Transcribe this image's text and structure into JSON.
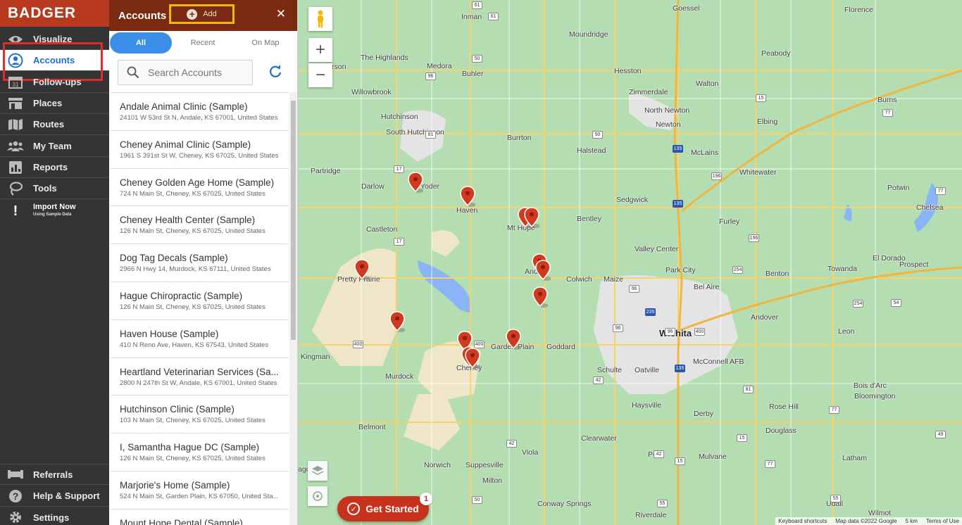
{
  "app": {
    "logo": "BADGER"
  },
  "nav": {
    "items": [
      {
        "label": "Visualize",
        "icon": "eye-icon"
      },
      {
        "label": "Accounts",
        "icon": "user-circle-icon"
      },
      {
        "label": "Follow-ups",
        "icon": "calendar-icon",
        "icon_text": "31"
      },
      {
        "label": "Places",
        "icon": "store-icon"
      },
      {
        "label": "Routes",
        "icon": "map-icon"
      },
      {
        "label": "My Team",
        "icon": "team-icon"
      },
      {
        "label": "Reports",
        "icon": "chart-icon"
      },
      {
        "label": "Tools",
        "icon": "lasso-icon"
      }
    ],
    "import": {
      "title": "Import Now",
      "subtitle": "Using Sample Data"
    },
    "bottom": [
      {
        "label": "Referrals",
        "icon": "referral-icon"
      },
      {
        "label": "Help & Support",
        "icon": "help-icon"
      },
      {
        "label": "Settings",
        "icon": "gear-icon"
      }
    ]
  },
  "panel": {
    "title": "Accounts",
    "add_label": "Add",
    "close_label": "✕",
    "tabs": [
      "All",
      "Recent",
      "On Map"
    ],
    "search_placeholder": "Search Accounts",
    "accounts": [
      {
        "name": "Andale Animal Clinic (Sample)",
        "address": "24101 W 53rd St N, Andale, KS 67001, United States"
      },
      {
        "name": "Cheney Animal Clinic (Sample)",
        "address": "1961 S 391st St W, Cheney, KS 67025, United States"
      },
      {
        "name": "Cheney Golden Age Home (Sample)",
        "address": "724 N Main St, Cheney, KS 67025, United States"
      },
      {
        "name": "Cheney Health Center (Sample)",
        "address": "126 N Main St, Cheney, KS 67025, United States"
      },
      {
        "name": "Dog Tag Decals (Sample)",
        "address": "2966 N Hwy 14, Murdock, KS 67111, United States"
      },
      {
        "name": "Hague Chiropractic (Sample)",
        "address": "126 N Main St, Cheney, KS 67025, United States"
      },
      {
        "name": "Haven House (Sample)",
        "address": "410 N Reno Ave, Haven, KS 67543, United States"
      },
      {
        "name": "Heartland Veterinarian Services (Sa...",
        "address": "2800 N 247th St W, Andale, KS 67001, United States"
      },
      {
        "name": "Hutchinson Clinic (Sample)",
        "address": "103 N Main St, Cheney, KS 67025, United States"
      },
      {
        "name": "I, Samantha Hague DC (Sample)",
        "address": "126 N Main St, Cheney, KS 67025, United States"
      },
      {
        "name": "Marjorie's Home (Sample)",
        "address": "524 N Main St, Garden Plain, KS 67050, United Sta..."
      },
      {
        "name": "Mount Hope Dental (Sample)",
        "address": ""
      }
    ]
  },
  "map": {
    "towns": [
      {
        "name": "Goessel"
      },
      {
        "name": "Florence"
      },
      {
        "name": "Inman"
      },
      {
        "name": "Moundridge"
      },
      {
        "name": "Peabody"
      },
      {
        "name": "The Highlands"
      },
      {
        "name": "Medora"
      },
      {
        "name": "Buhler"
      },
      {
        "name": "Hesston"
      },
      {
        "name": "rson"
      },
      {
        "name": "Willowbrook"
      },
      {
        "name": "Zimmerdale"
      },
      {
        "name": "Walton"
      },
      {
        "name": "Hutchinson"
      },
      {
        "name": "North Newton"
      },
      {
        "name": "Newton"
      },
      {
        "name": "Burns"
      },
      {
        "name": "South Hutchinson"
      },
      {
        "name": "Burrton"
      },
      {
        "name": "Elbing"
      },
      {
        "name": "Halstead"
      },
      {
        "name": "McLains"
      },
      {
        "name": "Partridge"
      },
      {
        "name": "Whitewater"
      },
      {
        "name": "Darlow"
      },
      {
        "name": "Yoder"
      },
      {
        "name": "Potwin"
      },
      {
        "name": "Haven"
      },
      {
        "name": "Sedgwick"
      },
      {
        "name": "Chelsea"
      },
      {
        "name": "Mt Hope"
      },
      {
        "name": "Bentley"
      },
      {
        "name": "Furley"
      },
      {
        "name": "Castleton"
      },
      {
        "name": "Valley Center"
      },
      {
        "name": "Andale"
      },
      {
        "name": "Park City"
      },
      {
        "name": "El Dorado"
      },
      {
        "name": "Prospect"
      },
      {
        "name": "Benton"
      },
      {
        "name": "Towanda"
      },
      {
        "name": "Pretty Prairie"
      },
      {
        "name": "Colwich"
      },
      {
        "name": "Maize"
      },
      {
        "name": "Bel Aire"
      },
      {
        "name": "Andover"
      },
      {
        "name": "Wichita"
      },
      {
        "name": "Garden Plain"
      },
      {
        "name": "Goddard"
      },
      {
        "name": "Leon"
      },
      {
        "name": "Kingman"
      },
      {
        "name": "Cheney"
      },
      {
        "name": "McConnell AFB"
      },
      {
        "name": "Murdock"
      },
      {
        "name": "Schulte"
      },
      {
        "name": "Oatville"
      },
      {
        "name": "Bois d'Arc"
      },
      {
        "name": "Bloomington"
      },
      {
        "name": "Haysville"
      },
      {
        "name": "Rose Hill"
      },
      {
        "name": "Derby"
      },
      {
        "name": "Belmont"
      },
      {
        "name": "Douglass"
      },
      {
        "name": "Clearwater"
      },
      {
        "name": "Peck"
      },
      {
        "name": "Mulvane"
      },
      {
        "name": "Latham"
      },
      {
        "name": "ago"
      },
      {
        "name": "Norwich"
      },
      {
        "name": "Suppesville"
      },
      {
        "name": "Viola"
      },
      {
        "name": "Milton"
      },
      {
        "name": "Conway Springs"
      },
      {
        "name": "Udall"
      },
      {
        "name": "Wilmot"
      },
      {
        "name": "Riverdale"
      }
    ],
    "shields": [
      "61",
      "50",
      "96",
      "81",
      "77",
      "50",
      "135",
      "61",
      "15",
      "196",
      "135",
      "17",
      "17",
      "254",
      "196",
      "77",
      "96",
      "254",
      "235",
      "54",
      "42",
      "135",
      "400",
      "400",
      "96",
      "96",
      "400",
      "81",
      "42",
      "77",
      "49",
      "15",
      "42",
      "55",
      "15",
      "77",
      "55",
      "50"
    ],
    "pegman_icon": "pegman-icon",
    "zoom_in": "+",
    "zoom_out": "−",
    "get_started": "Get Started",
    "get_started_badge": "1",
    "attribution": [
      "Keyboard shortcuts",
      "Map data ©2022 Google",
      "5 km",
      "Terms of Use"
    ]
  }
}
